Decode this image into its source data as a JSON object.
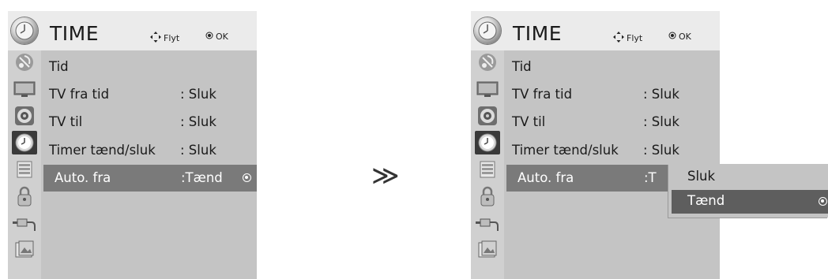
{
  "left_menu": {
    "title": "TIME",
    "hint_move": "Flyt",
    "hint_ok": "OK",
    "rows": [
      {
        "label": "Tid",
        "value": ""
      },
      {
        "label": "TV fra tid",
        "value": ": Sluk"
      },
      {
        "label": "TV til",
        "value": ": Sluk"
      },
      {
        "label": "Timer tænd/sluk",
        "value": ": Sluk"
      },
      {
        "label": "Auto. fra",
        "value": ":Tænd"
      }
    ],
    "selected_index": 4
  },
  "arrow": "≫",
  "right_menu": {
    "title": "TIME",
    "hint_move": "Flyt",
    "hint_ok": "OK",
    "rows": [
      {
        "label": "Tid",
        "value": ""
      },
      {
        "label": "TV fra tid",
        "value": ": Sluk"
      },
      {
        "label": "TV til",
        "value": ": Sluk"
      },
      {
        "label": "Timer tænd/sluk",
        "value": ": Sluk"
      },
      {
        "label": "Auto. fra",
        "value": ":T"
      }
    ],
    "selected_index": 4,
    "popup": {
      "options": [
        "Sluk",
        "Tænd"
      ],
      "selected_index": 1
    }
  },
  "sidebar_icons": [
    "satellite-icon",
    "screen-icon",
    "audio-icon",
    "clock-icon",
    "settings-icon",
    "lock-icon",
    "input-plug-icon",
    "photo-icon"
  ],
  "colors": {
    "header_bg": "#ebebeb",
    "sidebar_bg": "#d0d0d0",
    "content_bg": "#c4c4c4",
    "selected_row": "#7a7a7a",
    "selected_popup": "#5e5e5e"
  }
}
